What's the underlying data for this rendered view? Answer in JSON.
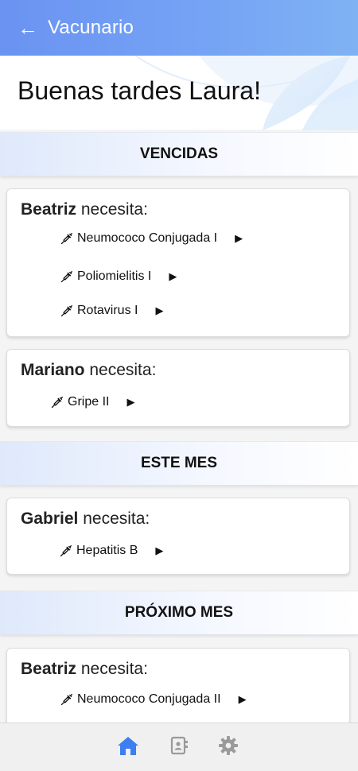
{
  "appbar": {
    "back_icon": "arrow-left-icon",
    "title": "Vacunario"
  },
  "greeting": "Buenas tardes Laura!",
  "colors": {
    "accent": "#3d7ef0",
    "appbar": "#6f9cf4",
    "section_bg": "#e3ecfb",
    "nav_inactive": "#9a9a9a"
  },
  "sections": [
    {
      "title": "VENCIDAS",
      "cards": [
        {
          "name": "Beatriz",
          "suffix": " necesita:",
          "items": [
            {
              "label": "Neumococo Conjugada I"
            },
            {
              "label": "Poliomielitis I"
            },
            {
              "label": "Rotavirus I"
            }
          ]
        },
        {
          "name": "Mariano",
          "suffix": " necesita:",
          "items": [
            {
              "label": "Gripe II"
            }
          ]
        }
      ]
    },
    {
      "title": "ESTE MES",
      "cards": [
        {
          "name": "Gabriel",
          "suffix": " necesita:",
          "items": [
            {
              "label": "Hepatitis B"
            }
          ]
        }
      ]
    },
    {
      "title": "PRÓXIMO MES",
      "cards": [
        {
          "name": "Beatriz",
          "suffix": " necesita:",
          "items": [
            {
              "label": "Neumococo Conjugada II"
            }
          ]
        }
      ]
    }
  ],
  "bottom_nav": [
    {
      "icon": "home-icon",
      "active": true
    },
    {
      "icon": "contacts-icon",
      "active": false
    },
    {
      "icon": "gear-icon",
      "active": false
    }
  ]
}
